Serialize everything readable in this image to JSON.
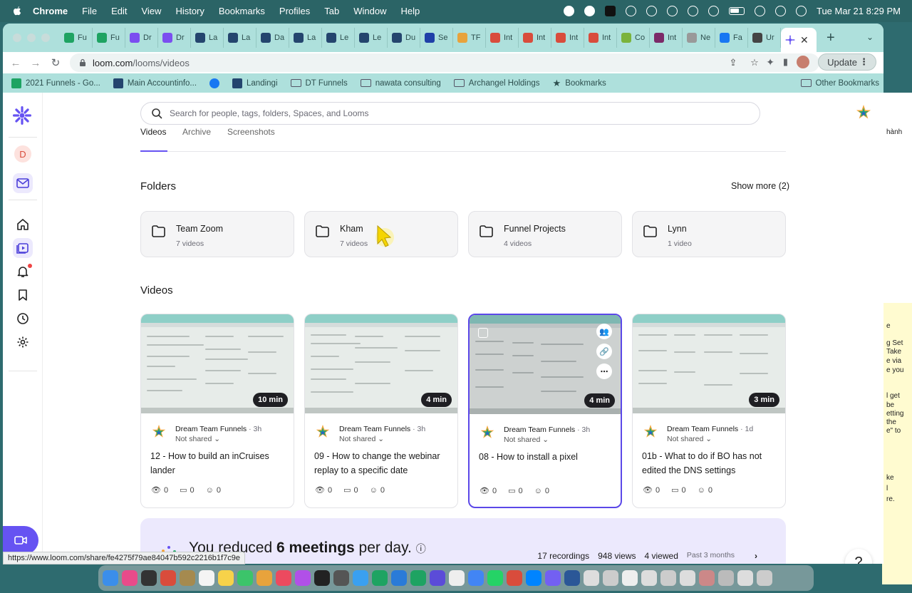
{
  "menubar": {
    "app": "Chrome",
    "items": [
      "File",
      "Edit",
      "View",
      "History",
      "Bookmarks",
      "Profiles",
      "Tab",
      "Window",
      "Help"
    ],
    "datetime": "Tue Mar 21  8:29 PM"
  },
  "browser": {
    "tabs": [
      {
        "label": "Fu",
        "color": "#1ea362"
      },
      {
        "label": "Fu",
        "color": "#1ea362"
      },
      {
        "label": "Dr",
        "color": "#7b4ef0"
      },
      {
        "label": "Dr",
        "color": "#7b4ef0"
      },
      {
        "label": "La",
        "color": "#24456e"
      },
      {
        "label": "La",
        "color": "#24456e"
      },
      {
        "label": "Da",
        "color": "#24456e"
      },
      {
        "label": "La",
        "color": "#24456e"
      },
      {
        "label": "Le",
        "color": "#24456e"
      },
      {
        "label": "Le",
        "color": "#24456e"
      },
      {
        "label": "Du",
        "color": "#24456e"
      },
      {
        "label": "Se",
        "color": "#1f3fa8"
      },
      {
        "label": "TF",
        "color": "#e8a33c"
      },
      {
        "label": "Int",
        "color": "#d94c3c"
      },
      {
        "label": "Int",
        "color": "#d94c3c"
      },
      {
        "label": "Int",
        "color": "#d94c3c"
      },
      {
        "label": "Int",
        "color": "#d94c3c"
      },
      {
        "label": "Co",
        "color": "#7bb33c"
      },
      {
        "label": "Int",
        "color": "#7c2a68"
      },
      {
        "label": "Ne",
        "color": "#999999"
      },
      {
        "label": "Fa",
        "color": "#1877f2"
      },
      {
        "label": "Ur",
        "color": "#444444"
      }
    ],
    "url_host": "loom.com",
    "url_path": "/looms/videos",
    "update_label": "Update",
    "bookmarks": [
      {
        "label": "2021 Funnels - Go...",
        "type": "sheet"
      },
      {
        "label": "Main Accountinfo...",
        "type": "v"
      },
      {
        "label": "",
        "type": "facebook"
      },
      {
        "label": "Landingi",
        "type": "v"
      },
      {
        "label": "DT Funnels",
        "type": "folder"
      },
      {
        "label": "nawata consulting",
        "type": "folder"
      },
      {
        "label": "Archangel Holdings",
        "type": "folder"
      },
      {
        "label": "Bookmarks",
        "type": "star"
      }
    ],
    "other_bookmarks": "Other Bookmarks",
    "status_url": "https://www.loom.com/share/fe4275f79ae84047b592c2216b1f7c9e"
  },
  "sidebar": {
    "avatar_letter": "D"
  },
  "search": {
    "placeholder": "Search for people, tags, folders, Spaces, and Looms"
  },
  "subtabs": [
    "Videos",
    "Archive",
    "Screenshots"
  ],
  "folders": {
    "title": "Folders",
    "show_more": "Show more (2)",
    "items": [
      {
        "name": "Team Zoom",
        "count": "7 videos"
      },
      {
        "name": "Kham",
        "count": "7 videos"
      },
      {
        "name": "Funnel Projects",
        "count": "4 videos"
      },
      {
        "name": "Lynn",
        "count": "1 video"
      }
    ]
  },
  "videos": {
    "title": "Videos",
    "items": [
      {
        "duration": "10 min",
        "author": "Dream Team Funnels",
        "time": "· 3h",
        "share": "Not shared ⌄",
        "title": "12 - How to build an inCruises lander",
        "views": "0",
        "comments": "0",
        "reactions": "0"
      },
      {
        "duration": "4 min",
        "author": "Dream Team Funnels",
        "time": "· 3h",
        "share": "Not shared ⌄",
        "title": "09 - How to change the webinar replay to a specific date",
        "views": "0",
        "comments": "0",
        "reactions": "0"
      },
      {
        "duration": "4 min",
        "author": "Dream Team Funnels",
        "time": "· 3h",
        "share": "Not shared ⌄",
        "title": "08 - How to install a pixel",
        "views": "0",
        "comments": "0",
        "reactions": "0"
      },
      {
        "duration": "3 min",
        "author": "Dream Team Funnels",
        "time": "· 1d",
        "share": "Not shared ⌄",
        "title": "01b - What to do if BO has not edited the DNS settings",
        "views": "0",
        "comments": "0",
        "reactions": "0"
      }
    ]
  },
  "banner": {
    "prefix": "You reduced ",
    "bold": "6 meetings",
    "suffix": " per day.",
    "recordings": "17 recordings",
    "views": "948 views",
    "viewed": "4 viewed",
    "period": "Past 3 months"
  },
  "help_label": "?",
  "background_window_text": [
    "hành",
    "e",
    "g Set",
    "Take",
    "e via",
    "e you",
    "l get",
    "be",
    "etting",
    "the",
    "e\" to",
    "ke",
    "l",
    "re."
  ],
  "colors": {
    "loom_purple": "#6653f2",
    "selected_border": "#5b48e8",
    "tab_strip": "#aee0dc"
  }
}
